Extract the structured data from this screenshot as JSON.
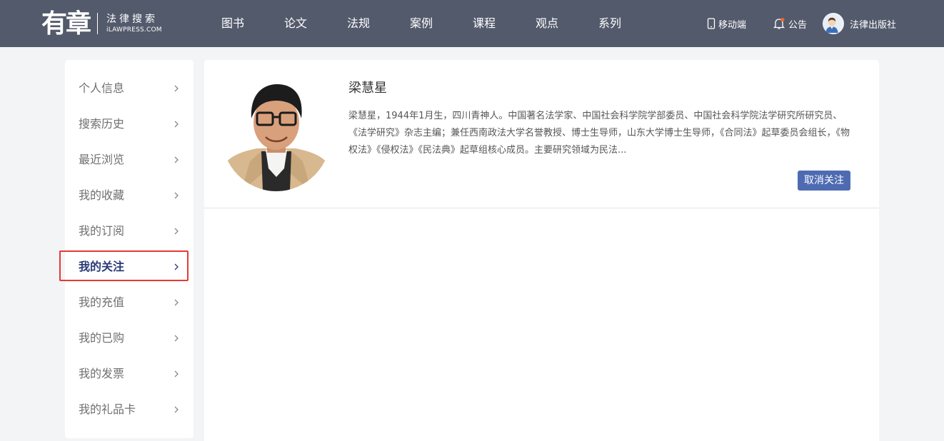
{
  "brand": {
    "logo_text": "有章",
    "name_cn": "法律搜索",
    "name_en": "iLAWPRESS.COM"
  },
  "nav": [
    {
      "label": "图书"
    },
    {
      "label": "论文"
    },
    {
      "label": "法规"
    },
    {
      "label": "案例"
    },
    {
      "label": "课程"
    },
    {
      "label": "观点"
    },
    {
      "label": "系列"
    }
  ],
  "top_right": {
    "mobile_label": "移动端",
    "notice_label": "公告",
    "user_name": "法律出版社"
  },
  "sidebar": {
    "items": [
      {
        "label": "个人信息"
      },
      {
        "label": "搜索历史"
      },
      {
        "label": "最近浏览"
      },
      {
        "label": "我的收藏"
      },
      {
        "label": "我的订阅"
      },
      {
        "label": "我的关注",
        "active": true
      },
      {
        "label": "我的充值"
      },
      {
        "label": "我的已购"
      },
      {
        "label": "我的发票"
      },
      {
        "label": "我的礼品卡"
      }
    ]
  },
  "follow_card": {
    "name": "梁慧星",
    "bio": "梁慧星，1944年1月生，四川青神人。中国著名法学家、中国社会科学院学部委员、中国社会科学院法学研究所研究员、《法学研究》杂志主编；兼任西南政法大学名誉教授、博士生导师，山东大学博士生导师，《合同法》起草委员会组长，《物权法》《侵权法》《民法典》起草组核心成员。主要研究领域为民法...",
    "unfollow_label": "取消关注"
  },
  "colors": {
    "topbar": "#535a6c",
    "active_text": "#2b3a78",
    "highlight": "#e53935",
    "button": "#4e6bb2"
  }
}
